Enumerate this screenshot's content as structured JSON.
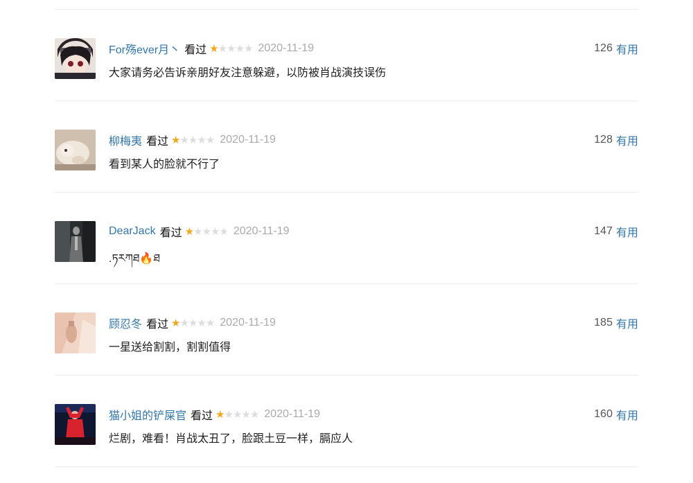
{
  "watched_label": "看过",
  "useful_label": "有用",
  "star_color": "#f4a61d",
  "user_link_color": "#3377aa",
  "comments": [
    {
      "user": "For殇ever月丶",
      "rating": 1,
      "date": "2020-11-19",
      "votes": "126",
      "text": "大家请务必告诉亲朋好友注意躲避，以防被肖战演技误伤"
    },
    {
      "user": "柳梅夷",
      "rating": 1,
      "date": "2020-11-19",
      "votes": "128",
      "text": "看到某人的脸就不行了"
    },
    {
      "user": "DearJack",
      "rating": 1,
      "date": "2020-11-19",
      "votes": "147",
      "text": ".ཏརཀཐ🔥ཐ"
    },
    {
      "user": "顾忍冬",
      "rating": 1,
      "date": "2020-11-19",
      "votes": "185",
      "text": "一星送给割割，割割值得"
    },
    {
      "user": "猫小姐的铲屎官",
      "rating": 1,
      "date": "2020-11-19",
      "votes": "160",
      "text": "烂剧，难看！肖战太丑了，脸跟土豆一样，膈应人"
    }
  ]
}
